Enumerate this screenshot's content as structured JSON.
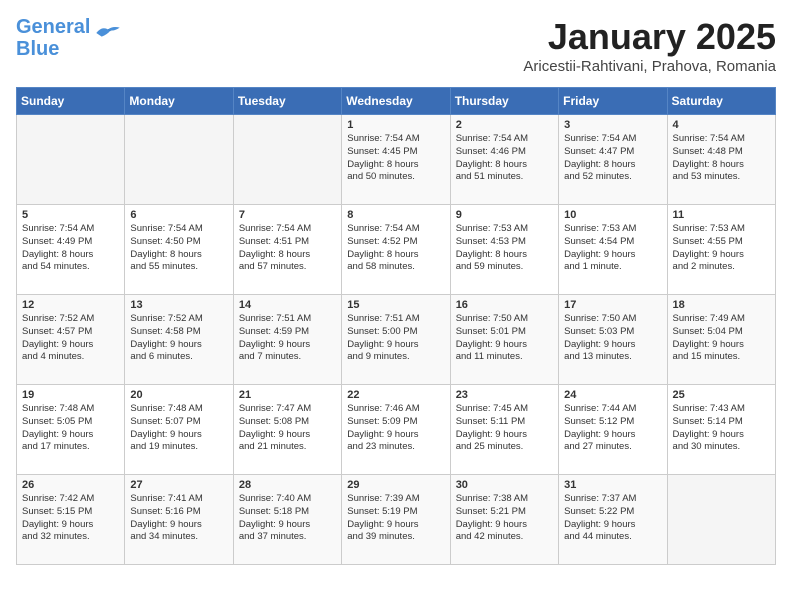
{
  "header": {
    "logo_line1": "General",
    "logo_line2": "Blue",
    "month_title": "January 2025",
    "subtitle": "Aricestii-Rahtivani, Prahova, Romania"
  },
  "weekdays": [
    "Sunday",
    "Monday",
    "Tuesday",
    "Wednesday",
    "Thursday",
    "Friday",
    "Saturday"
  ],
  "weeks": [
    [
      {
        "day": "",
        "info": ""
      },
      {
        "day": "",
        "info": ""
      },
      {
        "day": "",
        "info": ""
      },
      {
        "day": "1",
        "info": "Sunrise: 7:54 AM\nSunset: 4:45 PM\nDaylight: 8 hours\nand 50 minutes."
      },
      {
        "day": "2",
        "info": "Sunrise: 7:54 AM\nSunset: 4:46 PM\nDaylight: 8 hours\nand 51 minutes."
      },
      {
        "day": "3",
        "info": "Sunrise: 7:54 AM\nSunset: 4:47 PM\nDaylight: 8 hours\nand 52 minutes."
      },
      {
        "day": "4",
        "info": "Sunrise: 7:54 AM\nSunset: 4:48 PM\nDaylight: 8 hours\nand 53 minutes."
      }
    ],
    [
      {
        "day": "5",
        "info": "Sunrise: 7:54 AM\nSunset: 4:49 PM\nDaylight: 8 hours\nand 54 minutes."
      },
      {
        "day": "6",
        "info": "Sunrise: 7:54 AM\nSunset: 4:50 PM\nDaylight: 8 hours\nand 55 minutes."
      },
      {
        "day": "7",
        "info": "Sunrise: 7:54 AM\nSunset: 4:51 PM\nDaylight: 8 hours\nand 57 minutes."
      },
      {
        "day": "8",
        "info": "Sunrise: 7:54 AM\nSunset: 4:52 PM\nDaylight: 8 hours\nand 58 minutes."
      },
      {
        "day": "9",
        "info": "Sunrise: 7:53 AM\nSunset: 4:53 PM\nDaylight: 8 hours\nand 59 minutes."
      },
      {
        "day": "10",
        "info": "Sunrise: 7:53 AM\nSunset: 4:54 PM\nDaylight: 9 hours\nand 1 minute."
      },
      {
        "day": "11",
        "info": "Sunrise: 7:53 AM\nSunset: 4:55 PM\nDaylight: 9 hours\nand 2 minutes."
      }
    ],
    [
      {
        "day": "12",
        "info": "Sunrise: 7:52 AM\nSunset: 4:57 PM\nDaylight: 9 hours\nand 4 minutes."
      },
      {
        "day": "13",
        "info": "Sunrise: 7:52 AM\nSunset: 4:58 PM\nDaylight: 9 hours\nand 6 minutes."
      },
      {
        "day": "14",
        "info": "Sunrise: 7:51 AM\nSunset: 4:59 PM\nDaylight: 9 hours\nand 7 minutes."
      },
      {
        "day": "15",
        "info": "Sunrise: 7:51 AM\nSunset: 5:00 PM\nDaylight: 9 hours\nand 9 minutes."
      },
      {
        "day": "16",
        "info": "Sunrise: 7:50 AM\nSunset: 5:01 PM\nDaylight: 9 hours\nand 11 minutes."
      },
      {
        "day": "17",
        "info": "Sunrise: 7:50 AM\nSunset: 5:03 PM\nDaylight: 9 hours\nand 13 minutes."
      },
      {
        "day": "18",
        "info": "Sunrise: 7:49 AM\nSunset: 5:04 PM\nDaylight: 9 hours\nand 15 minutes."
      }
    ],
    [
      {
        "day": "19",
        "info": "Sunrise: 7:48 AM\nSunset: 5:05 PM\nDaylight: 9 hours\nand 17 minutes."
      },
      {
        "day": "20",
        "info": "Sunrise: 7:48 AM\nSunset: 5:07 PM\nDaylight: 9 hours\nand 19 minutes."
      },
      {
        "day": "21",
        "info": "Sunrise: 7:47 AM\nSunset: 5:08 PM\nDaylight: 9 hours\nand 21 minutes."
      },
      {
        "day": "22",
        "info": "Sunrise: 7:46 AM\nSunset: 5:09 PM\nDaylight: 9 hours\nand 23 minutes."
      },
      {
        "day": "23",
        "info": "Sunrise: 7:45 AM\nSunset: 5:11 PM\nDaylight: 9 hours\nand 25 minutes."
      },
      {
        "day": "24",
        "info": "Sunrise: 7:44 AM\nSunset: 5:12 PM\nDaylight: 9 hours\nand 27 minutes."
      },
      {
        "day": "25",
        "info": "Sunrise: 7:43 AM\nSunset: 5:14 PM\nDaylight: 9 hours\nand 30 minutes."
      }
    ],
    [
      {
        "day": "26",
        "info": "Sunrise: 7:42 AM\nSunset: 5:15 PM\nDaylight: 9 hours\nand 32 minutes."
      },
      {
        "day": "27",
        "info": "Sunrise: 7:41 AM\nSunset: 5:16 PM\nDaylight: 9 hours\nand 34 minutes."
      },
      {
        "day": "28",
        "info": "Sunrise: 7:40 AM\nSunset: 5:18 PM\nDaylight: 9 hours\nand 37 minutes."
      },
      {
        "day": "29",
        "info": "Sunrise: 7:39 AM\nSunset: 5:19 PM\nDaylight: 9 hours\nand 39 minutes."
      },
      {
        "day": "30",
        "info": "Sunrise: 7:38 AM\nSunset: 5:21 PM\nDaylight: 9 hours\nand 42 minutes."
      },
      {
        "day": "31",
        "info": "Sunrise: 7:37 AM\nSunset: 5:22 PM\nDaylight: 9 hours\nand 44 minutes."
      },
      {
        "day": "",
        "info": ""
      }
    ]
  ]
}
